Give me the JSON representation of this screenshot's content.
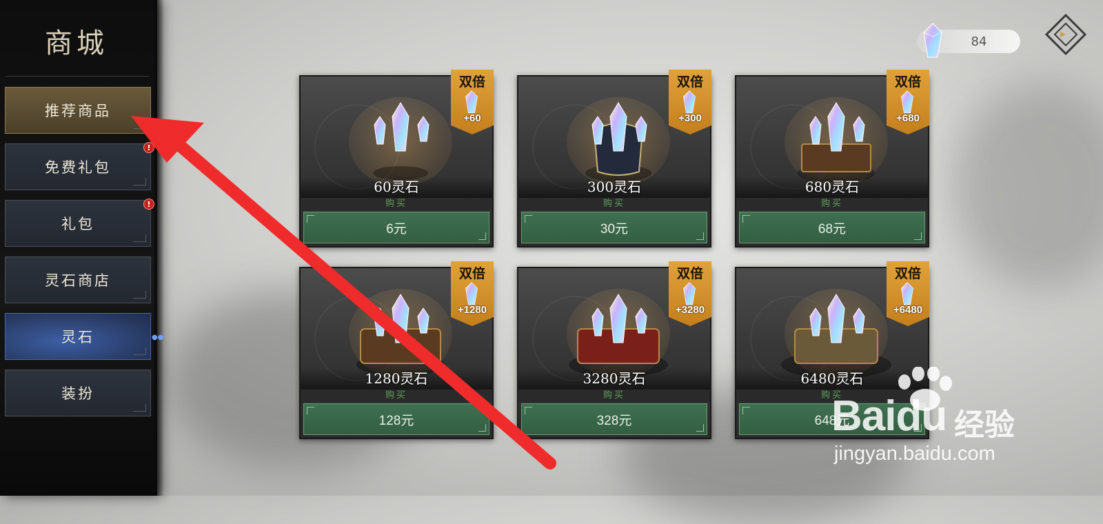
{
  "shop": {
    "title": "商城"
  },
  "sidebar": {
    "items": [
      {
        "label": "推荐商品",
        "state": "selected-gold"
      },
      {
        "label": "免费礼包",
        "alert": "!"
      },
      {
        "label": "礼包",
        "alert": "!"
      },
      {
        "label": "灵石商店"
      },
      {
        "label": "灵石",
        "state": "active-blue"
      },
      {
        "label": "装扮"
      }
    ]
  },
  "currency": {
    "icon": "spirit-stone-icon",
    "amount": "84"
  },
  "products": [
    {
      "name": "60灵石",
      "buy_label": "购买",
      "price": "6元",
      "badge_title": "双倍",
      "badge_bonus": "+60"
    },
    {
      "name": "300灵石",
      "buy_label": "购买",
      "price": "30元",
      "badge_title": "双倍",
      "badge_bonus": "+300"
    },
    {
      "name": "680灵石",
      "buy_label": "购买",
      "price": "68元",
      "badge_title": "双倍",
      "badge_bonus": "+680"
    },
    {
      "name": "1280灵石",
      "buy_label": "购买",
      "price": "128元",
      "badge_title": "双倍",
      "badge_bonus": "+1280"
    },
    {
      "name": "3280灵石",
      "buy_label": "购买",
      "price": "328元",
      "badge_title": "双倍",
      "badge_bonus": "+3280"
    },
    {
      "name": "6480灵石",
      "buy_label": "购买",
      "price": "648元",
      "badge_title": "双倍",
      "badge_bonus": "+6480"
    }
  ],
  "watermark": {
    "logo": "Baidu",
    "cn": "经验",
    "url": "jingyan.baidu.com"
  },
  "colors": {
    "annotation_arrow": "#f02b2b",
    "price_button": "#3a6849",
    "badge": "#d2901f",
    "sidebar_selected": "#5e4f33",
    "sidebar_active": "#34508a"
  }
}
